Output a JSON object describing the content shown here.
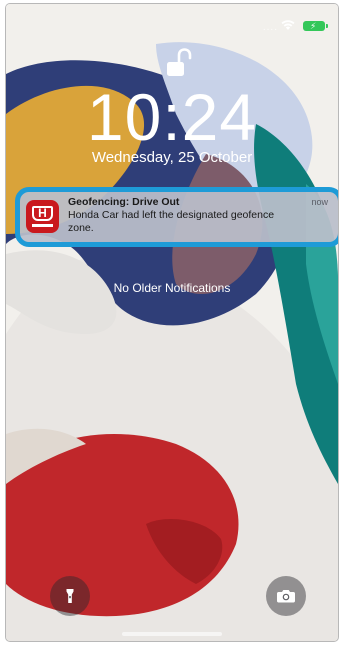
{
  "status_bar": {
    "signal": "....",
    "wifi_icon": "wifi-icon",
    "battery_icon": "battery-charging-icon",
    "battery_color": "#34c759"
  },
  "lock_icon": "unlocked-padlock-icon",
  "lock_screen": {
    "time": "10:24",
    "date": "Wednesday, 25 October"
  },
  "notification": {
    "app_icon": "honda-logo-icon",
    "app_icon_color": "#c9191e",
    "title": "Geofencing: Drive Out",
    "time": "now",
    "body": "Honda Car had left the designated geofence zone.",
    "highlight_color": "#1e9bd7"
  },
  "older_notifications": "No Older Notifications",
  "quick_actions": {
    "flashlight_icon": "flashlight-icon",
    "camera_icon": "camera-icon"
  }
}
